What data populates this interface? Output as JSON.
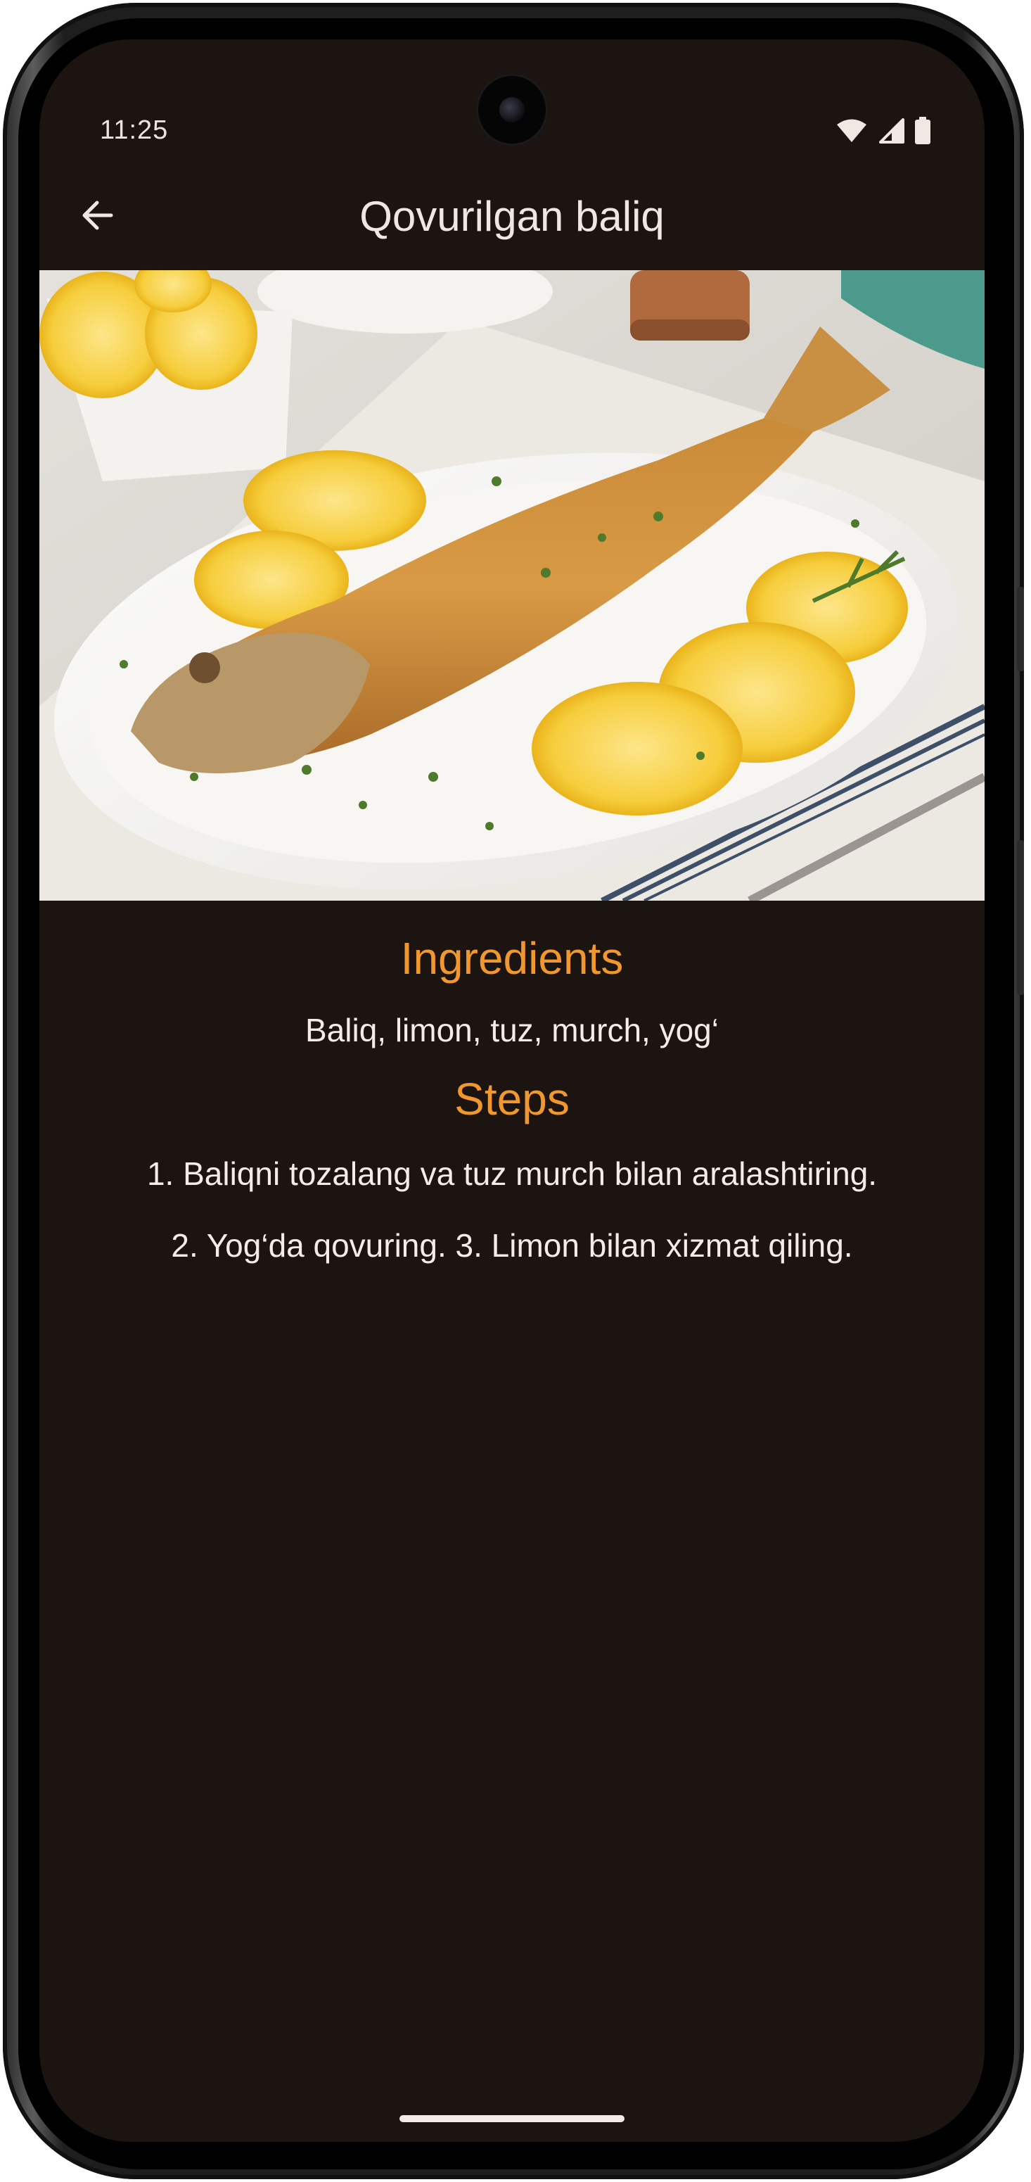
{
  "status_bar": {
    "time": "11:25",
    "icons": [
      "wifi-icon",
      "cellular-signal-icon",
      "battery-icon"
    ]
  },
  "app_bar": {
    "back_icon": "arrow-left-icon",
    "title": "Qovurilgan baliq"
  },
  "hero_image": {
    "subject": "fried-fish-with-lemon-slices-photo"
  },
  "ingredients": {
    "heading": "Ingredients",
    "text": "Baliq, limon, tuz, murch, yog‘"
  },
  "steps": {
    "heading": "Steps",
    "line1": "1. Baliqni tozalang va tuz murch bilan aralashtiring.",
    "line2": "2. Yog‘da qovuring. 3. Limon bilan xizmat qiling."
  },
  "colors": {
    "background": "#1b1411",
    "accent": "#f0972f",
    "text": "#f4ece8"
  }
}
